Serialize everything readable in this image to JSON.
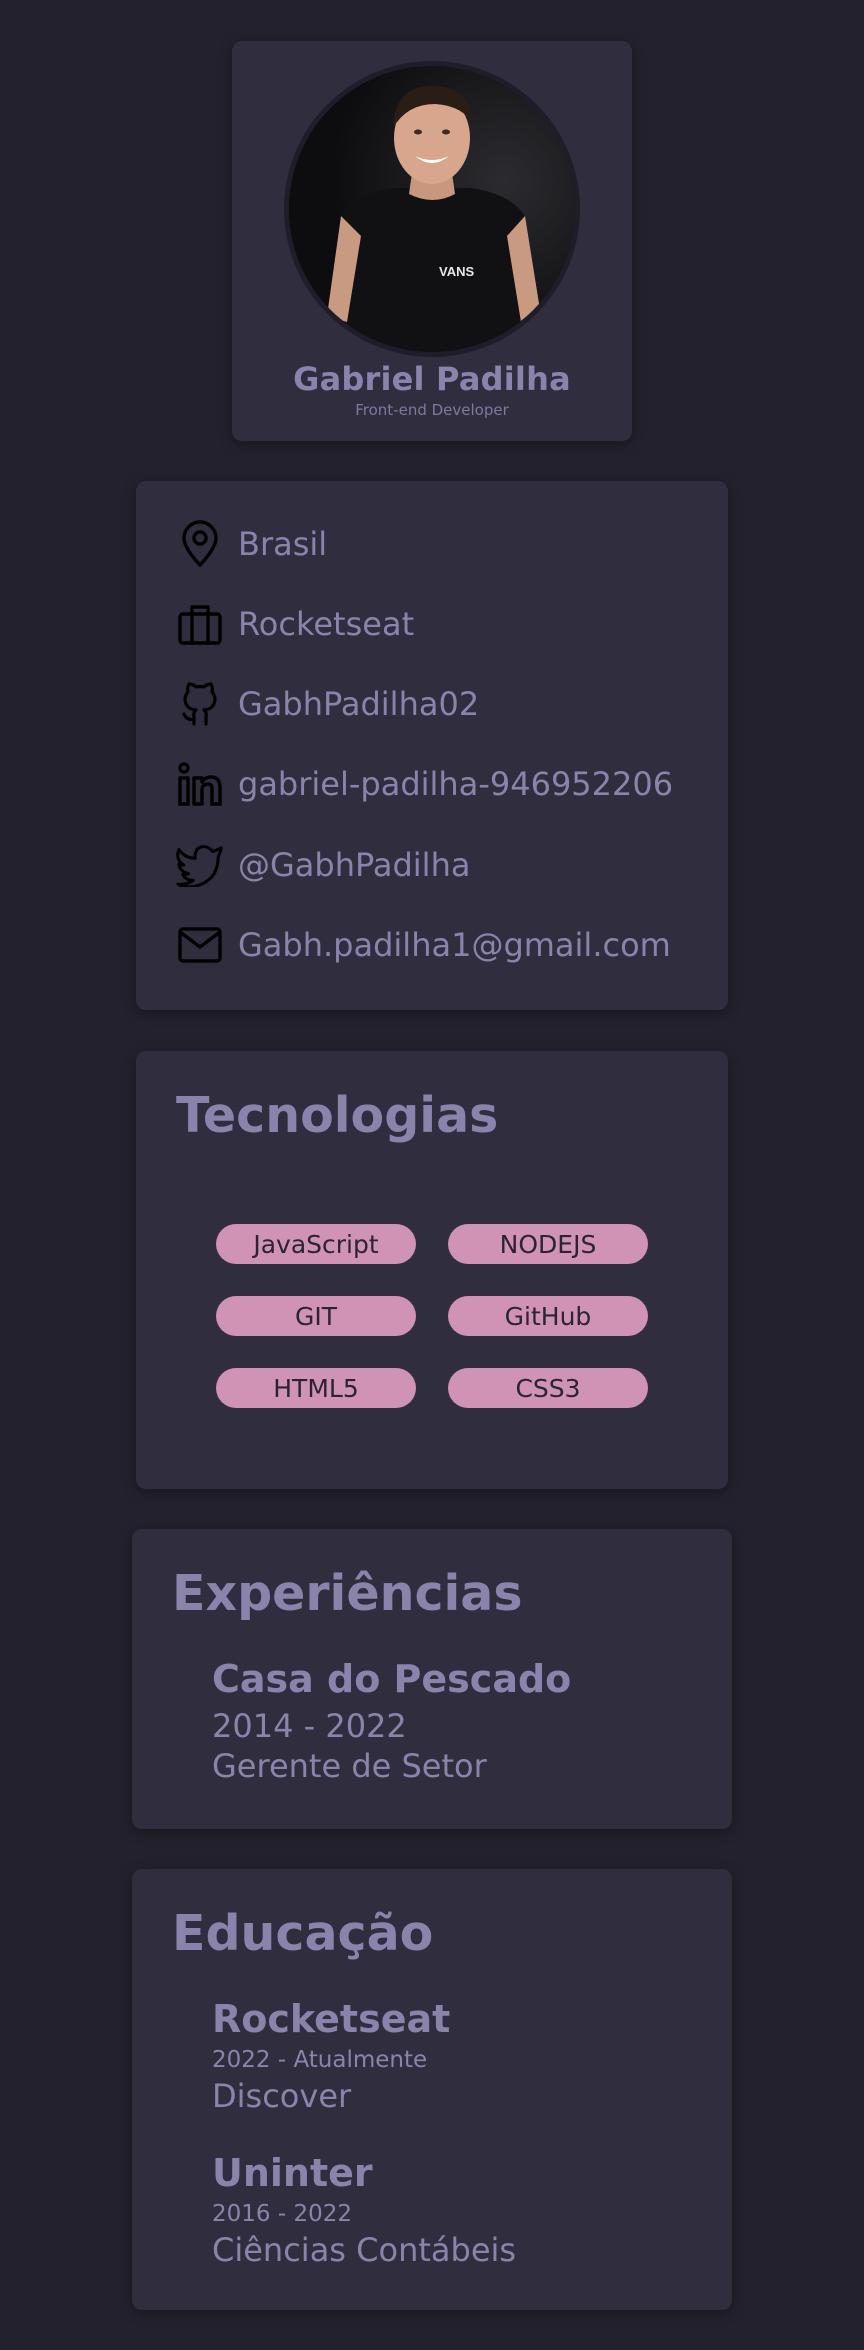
{
  "profile": {
    "name": "Gabriel Padilha",
    "role": "Front-end Developer",
    "avatar_alt": "profile photo"
  },
  "contacts": [
    {
      "icon": "map-pin-icon",
      "text": "Brasil"
    },
    {
      "icon": "briefcase-icon",
      "text": "Rocketseat"
    },
    {
      "icon": "github-icon",
      "text": "GabhPadilha02"
    },
    {
      "icon": "linkedin-icon",
      "text": "gabriel-padilha-946952206"
    },
    {
      "icon": "twitter-icon",
      "text": "@GabhPadilha"
    },
    {
      "icon": "mail-icon",
      "text": "Gabh.padilha1@gmail.com"
    }
  ],
  "tech": {
    "title": "Tecnologias",
    "items": [
      "JavaScript",
      "NODEJS",
      "GIT",
      "GitHub",
      "HTML5",
      "CSS3"
    ]
  },
  "experience": {
    "title": "Experiências",
    "items": [
      {
        "company": "Casa do Pescado",
        "period": "2014 - 2022",
        "role": "Gerente de Setor"
      }
    ]
  },
  "education": {
    "title": "Educação",
    "items": [
      {
        "school": "Rocketseat",
        "period": "2022 - Atualmente",
        "course": "Discover"
      },
      {
        "school": "Uninter",
        "period": "2016 - 2022",
        "course": "Ciências Contábeis"
      }
    ]
  },
  "colors": {
    "background": "#23212d",
    "card": "#302e3e",
    "text": "#8a84ad",
    "pill": "#d093b6",
    "pill_text": "#2a2433"
  }
}
